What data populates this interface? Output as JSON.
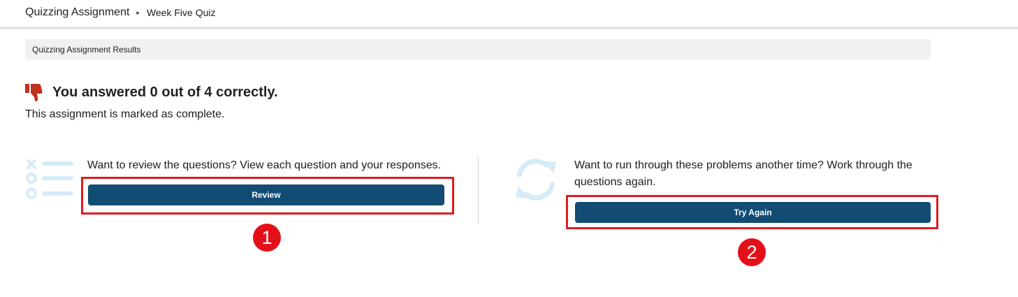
{
  "breadcrumb": {
    "root": "Quizzing Assignment",
    "separator": "▸",
    "current": "Week Five Quiz"
  },
  "results_header": "Quizzing Assignment Results",
  "score": {
    "icon": "thumbs-down-icon",
    "text": "You answered 0 out of 4 correctly.",
    "correct": 0,
    "total": 4
  },
  "status_text": "This assignment is marked as complete.",
  "review_panel": {
    "icon": "checklist-icon",
    "text": "Want to review the questions? View each question and your responses.",
    "button_label": "Review",
    "badge": "1"
  },
  "retry_panel": {
    "icon": "refresh-icon",
    "text": "Want to run through these problems another time? Work through the questions again.",
    "button_label": "Try Again",
    "badge": "2"
  },
  "colors": {
    "button": "#124c73",
    "thumb": "#c0311f",
    "highlight": "#e11b22",
    "badge": "#e3101a",
    "illustration": "#d5ebf9"
  }
}
